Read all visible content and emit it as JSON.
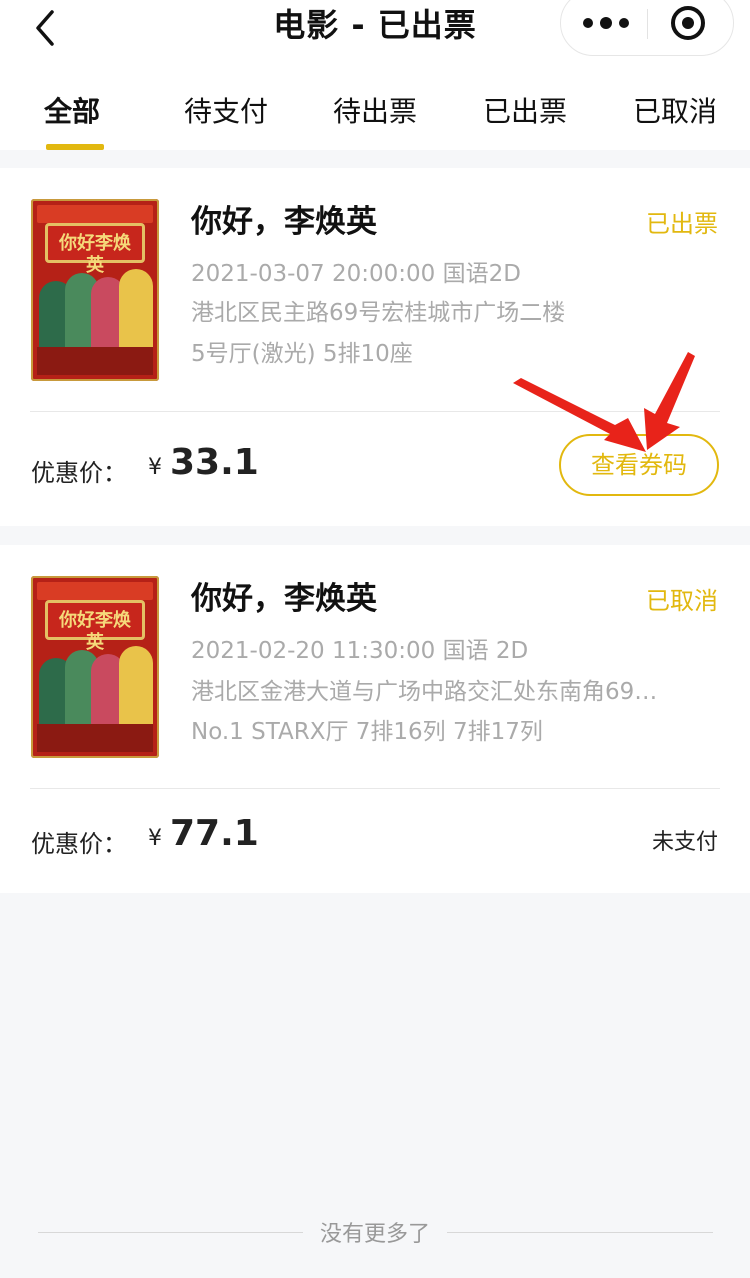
{
  "header": {
    "title": "电影 - 已出票",
    "back_icon": "chevron-left-icon",
    "more_icon": "more-dots-icon",
    "close_icon": "target-circle-icon"
  },
  "tabs": [
    {
      "label": "全部",
      "active": true
    },
    {
      "label": "待支付",
      "active": false
    },
    {
      "label": "待出票",
      "active": false
    },
    {
      "label": "已出票",
      "active": false
    },
    {
      "label": "已取消",
      "active": false
    }
  ],
  "orders": [
    {
      "movie": "你好，李焕英",
      "status": "已出票",
      "datetime": "2021-03-07 20:00:00 国语2D",
      "address": "港北区民主路69号宏桂城市广场二楼",
      "seat": "5号厅(激光) 5排10座",
      "price_label": "优惠价：",
      "currency": "¥",
      "price": "33.1",
      "action": "查看券码"
    },
    {
      "movie": "你好，李焕英",
      "status": "已取消",
      "datetime": "2021-02-20 11:30:00 国语 2D",
      "address": "港北区金港大道与广场中路交汇处东南角69…",
      "seat": "No.1 STARX厅 7排16列 7排17列",
      "price_label": "优惠价：",
      "currency": "¥",
      "price": "77.1",
      "pay_status": "未支付"
    }
  ],
  "footer": {
    "text": "没有更多了"
  },
  "colors": {
    "accent": "#e2b80f",
    "arrow": "#e8231a"
  }
}
